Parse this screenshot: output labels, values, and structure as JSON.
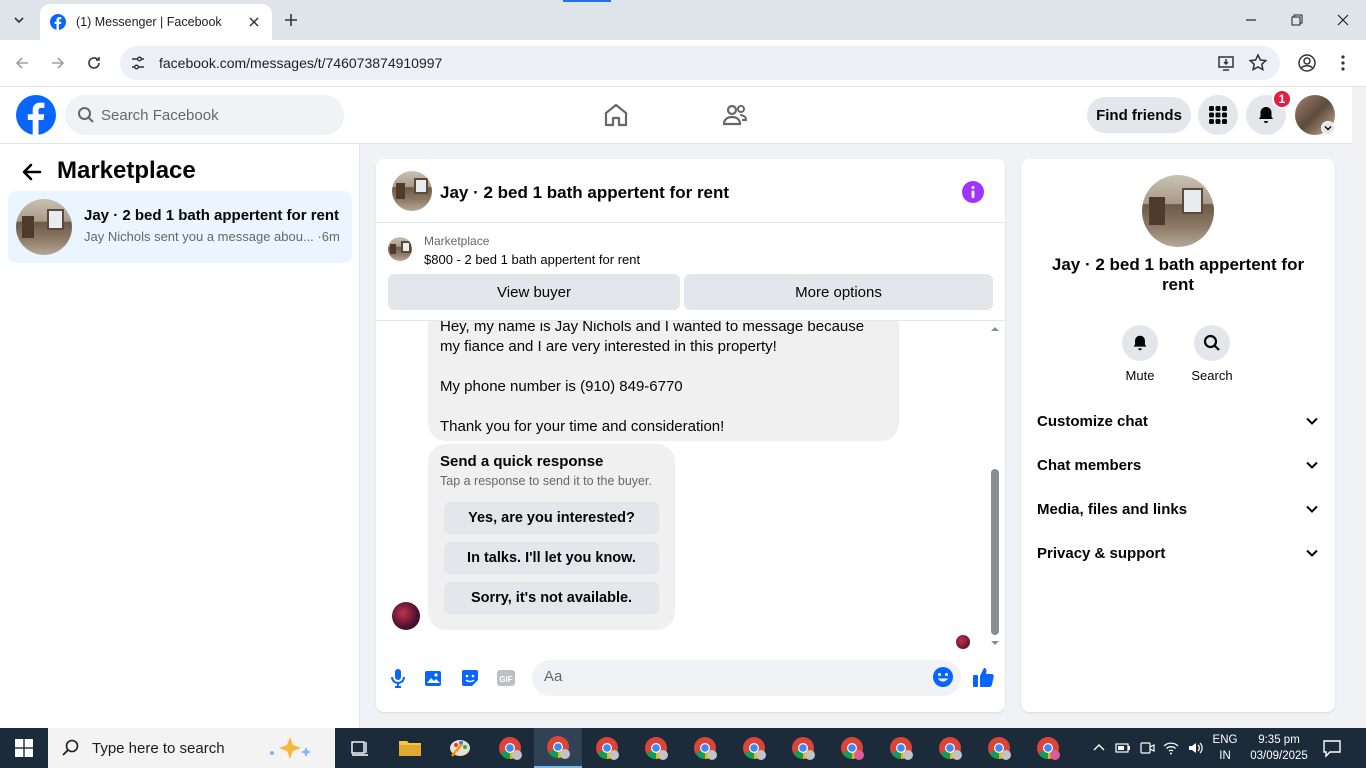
{
  "browser": {
    "tab_title": "(1) Messenger | Facebook",
    "url": "facebook.com/messages/t/746073874910997"
  },
  "fb": {
    "search_placeholder": "Search Facebook",
    "find_friends": "Find friends",
    "notification_count": "1",
    "brand_color": "#0866ff"
  },
  "sidebar": {
    "heading": "Marketplace",
    "thread": {
      "title": "Jay · 2 bed 1 bath appertent for rent",
      "preview": "Jay Nichols sent you a message abou... ·6m"
    }
  },
  "chat": {
    "title": "Jay · 2 bed 1 bath appertent for rent",
    "marketplace_label": "Marketplace",
    "listing": "$800 - 2 bed 1 bath appertent for rent",
    "view_buyer": "View buyer",
    "more_options": "More options",
    "message_lines": [
      "Hey, my name is Jay Nichols and I wanted to message because my fiance and I are very interested in this property!",
      "My phone number is (910) 849-6770",
      "Thank you for your time and consideration!"
    ],
    "quick_response": {
      "title": "Send a quick response",
      "subtitle": "Tap a response to send it to the buyer.",
      "options": [
        "Yes, are you interested?",
        "In talks. I'll let you know.",
        "Sorry, it's not available."
      ]
    },
    "compose_placeholder": "Aa"
  },
  "info": {
    "title": "Jay · 2 bed 1 bath appertent for rent",
    "actions": [
      "Mute",
      "Search"
    ],
    "sections": [
      "Customize chat",
      "Chat members",
      "Media, files and links",
      "Privacy & support"
    ]
  },
  "taskbar": {
    "search_placeholder": "Type here to search",
    "lang_1": "ENG",
    "lang_2": "IN",
    "time": "9:35 pm",
    "date": "03/09/2025"
  }
}
